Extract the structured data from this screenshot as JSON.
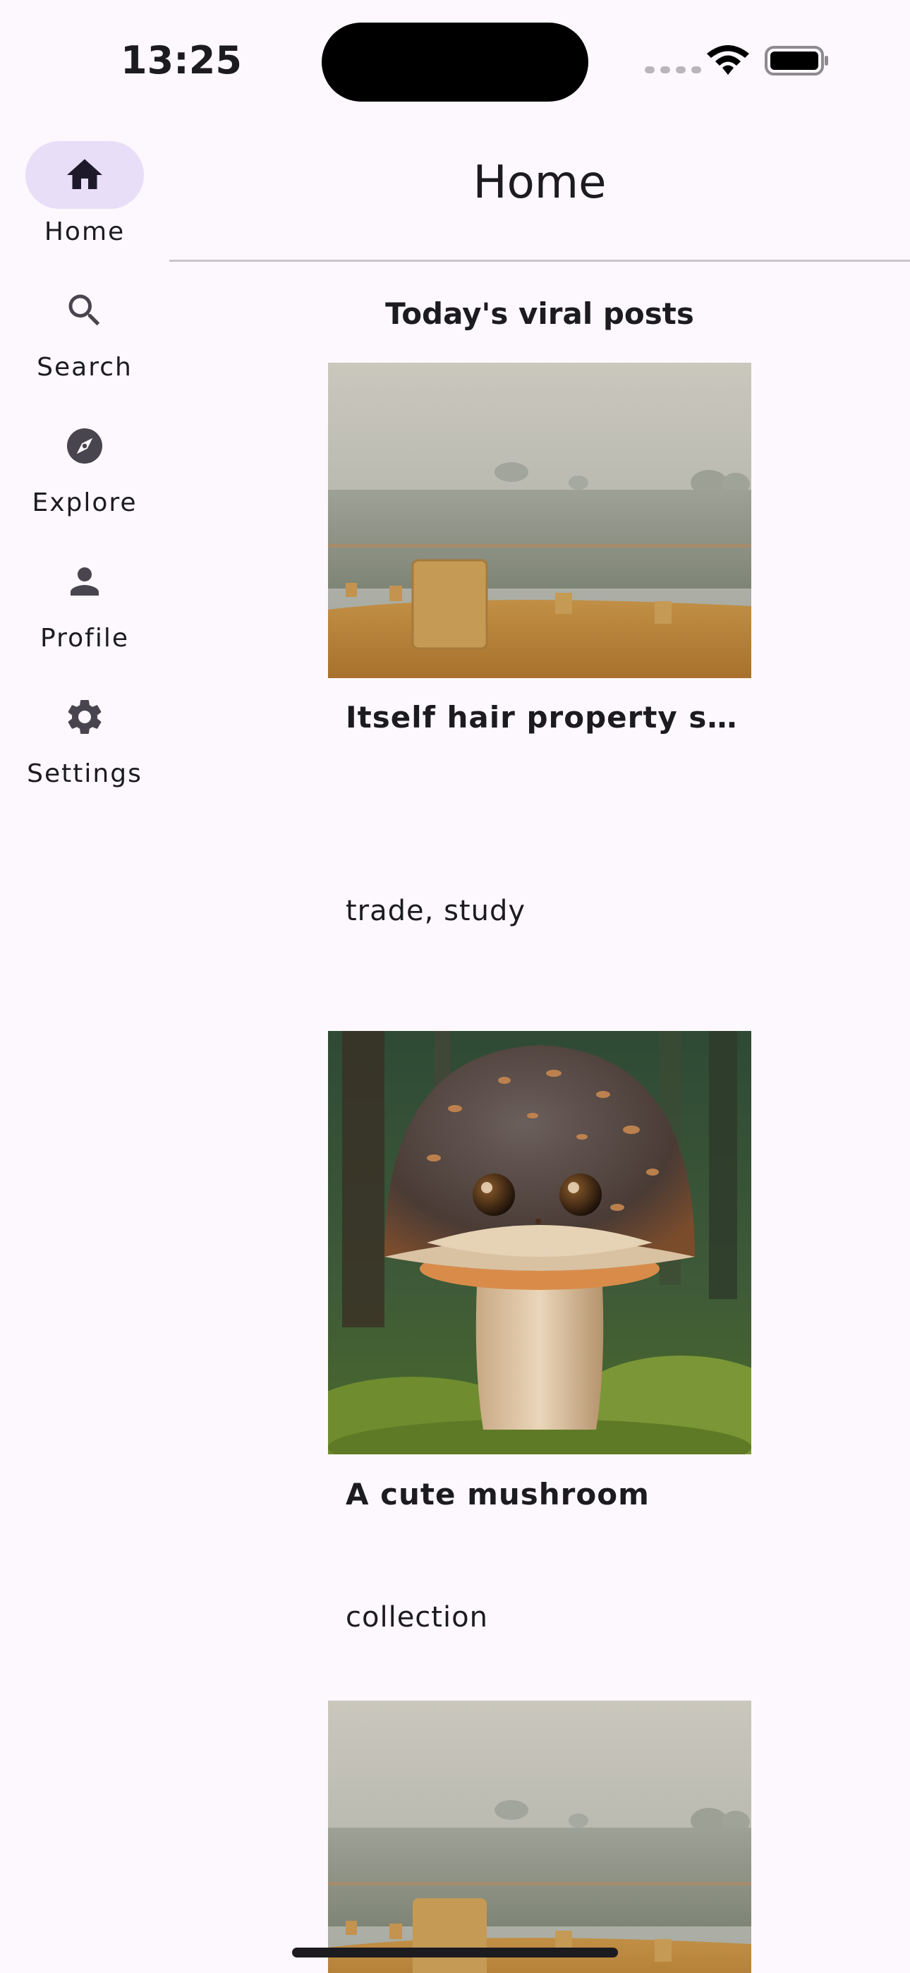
{
  "status_bar": {
    "time": "13:25",
    "icons": [
      "signal-dots-icon",
      "wifi-icon",
      "battery-icon"
    ]
  },
  "nav_rail": {
    "items": [
      {
        "label": "Home",
        "icon": "home-icon",
        "active": true
      },
      {
        "label": "Search",
        "icon": "search-icon",
        "active": false
      },
      {
        "label": "Explore",
        "icon": "compass-icon",
        "active": false
      },
      {
        "label": "Profile",
        "icon": "person-icon",
        "active": false
      },
      {
        "label": "Settings",
        "icon": "gear-icon",
        "active": false
      }
    ]
  },
  "header": {
    "title": "Home"
  },
  "feed": {
    "section_title": "Today's viral posts",
    "posts": [
      {
        "image": "hay-field-image",
        "title": "Itself hair property stat...",
        "tags": "trade, study"
      },
      {
        "image": "cute-mushroom-image",
        "title": "A cute mushroom",
        "tags": "collection"
      },
      {
        "image": "hay-field-image",
        "title": "",
        "tags": ""
      }
    ]
  },
  "colors": {
    "background": "#fdf8fd",
    "nav_indicator": "#e8def8",
    "text": "#1c1b1f",
    "icon": "#49454f",
    "divider": "#c9c5ca"
  }
}
